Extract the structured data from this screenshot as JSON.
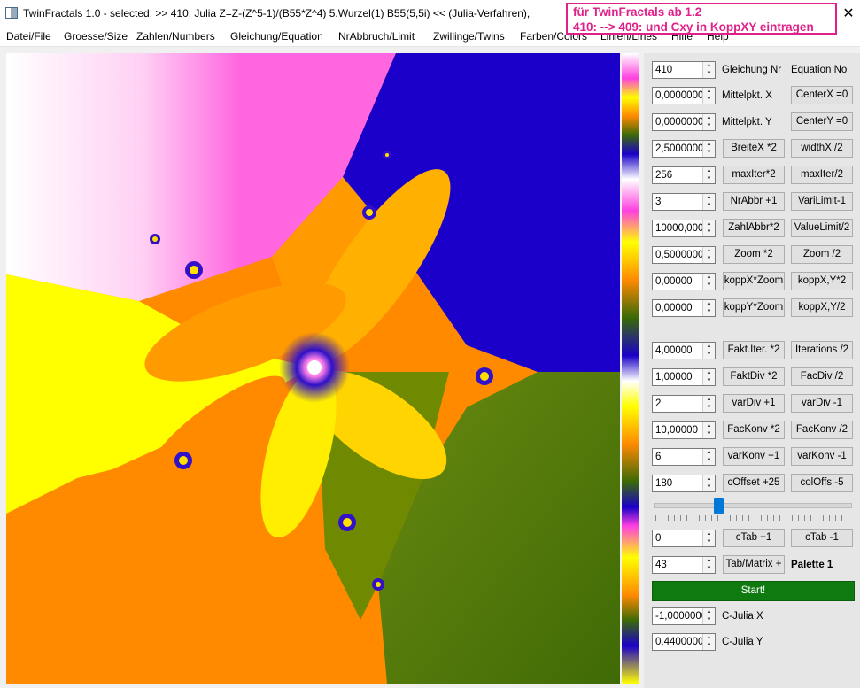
{
  "window": {
    "title": "TwinFractals 1.0 - selected: >> 410: Julia Z=Z-(Z^5-1)/(B55*Z^4) 5.Wurzel(1) B55(5,5i) << (Julia-Verfahren),",
    "close_glyph": "✕"
  },
  "note": {
    "line1": "für TwinFractals ab 1.2",
    "line2": "410: --> 409:  und Cxy in KoppXY eintragen",
    "color": "#e0218a"
  },
  "menu": [
    "Datei/File",
    "Groesse/Size",
    "Zahlen/Numbers",
    "Gleichung/Equation",
    "NrAbbruch/Limit",
    "Zwillinge/Twins",
    "Farben/Colors",
    "Linien/Lines",
    "Hilfe",
    "Help"
  ],
  "params": {
    "equation_nr": {
      "value": "410",
      "label": "Gleichung Nr",
      "button": "Equation No"
    },
    "center_x": {
      "value": "0,0000000",
      "label": "Mittelpkt. X",
      "button": "CenterX =0"
    },
    "center_y": {
      "value": "0,0000000",
      "label": "Mittelpkt. Y",
      "button": "CenterY =0"
    },
    "width_x": {
      "value": "2,5000000",
      "btn1": "BreiteX *2",
      "btn2": "widthX /2"
    },
    "max_iter": {
      "value": "256",
      "btn1": "maxIter*2",
      "btn2": "maxIter/2"
    },
    "nr_abbr": {
      "value": "3",
      "btn1": "NrAbbr +1",
      "btn2": "VariLimit-1"
    },
    "zahl_abbr": {
      "value": "10000,000",
      "btn1": "ZahlAbbr*2",
      "btn2": "ValueLimit/2"
    },
    "zoom": {
      "value": "0,5000000",
      "btn1": "Zoom *2",
      "btn2": "Zoom /2"
    },
    "kopp_x": {
      "value": "0,00000",
      "btn1": "koppX*Zoom",
      "btn2": "koppX,Y*2"
    },
    "kopp_y": {
      "value": "0,00000",
      "btn1": "koppY*Zoom",
      "btn2": "koppX,Y/2"
    },
    "fakt_iter": {
      "value": "4,00000",
      "btn1": "Fakt.Iter. *2",
      "btn2": "Iterations /2"
    },
    "fakt_div": {
      "value": "1,00000",
      "btn1": "FaktDiv *2",
      "btn2": "FacDiv /2"
    },
    "var_div": {
      "value": "2",
      "btn1": "varDiv +1",
      "btn2": "varDiv -1"
    },
    "fac_konv": {
      "value": "10,00000",
      "btn1": "FacKonv *2",
      "btn2": "FacKonv /2"
    },
    "var_konv": {
      "value": "6",
      "btn1": "varKonv +1",
      "btn2": "varKonv -1"
    },
    "c_offset": {
      "value": "180",
      "btn1": "cOffset +25",
      "btn2": "colOffs -5"
    },
    "c_tab": {
      "value": "0",
      "btn1": "cTab +1",
      "btn2": "cTab -1"
    },
    "tab_matrix": {
      "value": "43",
      "btn1": "Tab/Matrix +",
      "label": "Palette 1"
    }
  },
  "slider": {
    "value_fraction": 0.32
  },
  "start_button": {
    "label": "Start!",
    "color": "#0f7a0f"
  },
  "julia": {
    "cx": {
      "value": "-1,0000000",
      "label": "C-Julia X"
    },
    "cy": {
      "value": "0,4400000",
      "label": "C-Julia Y"
    }
  }
}
